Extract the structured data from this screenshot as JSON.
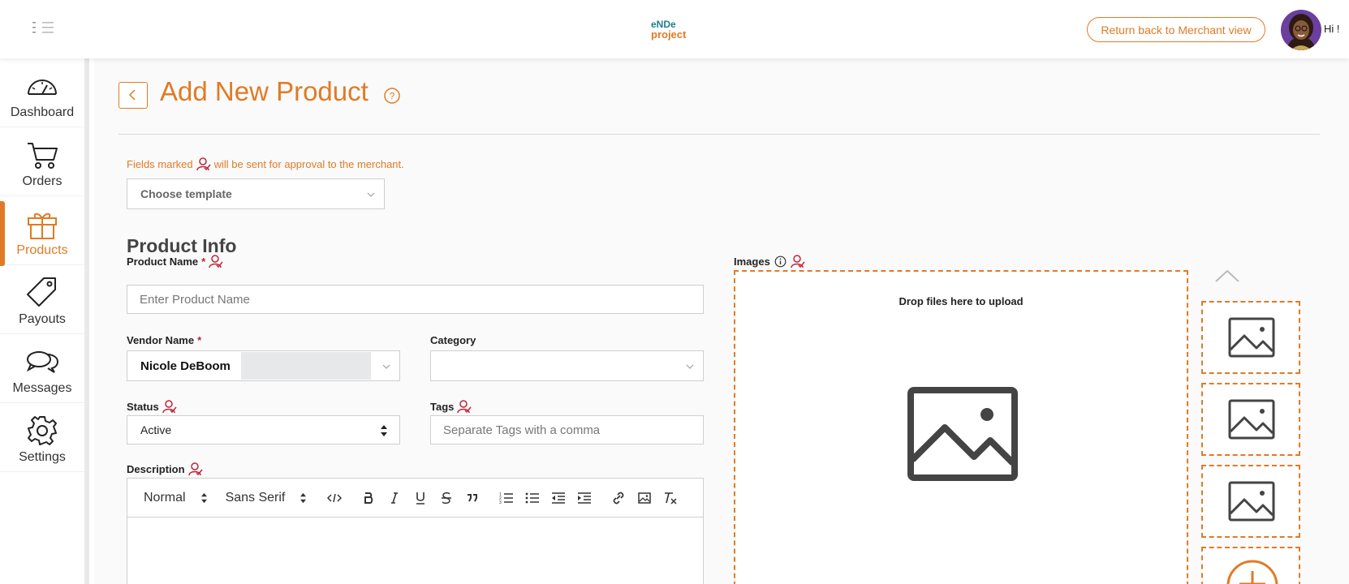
{
  "header": {
    "logo_line1": "eNDe",
    "logo_line2": "project",
    "merchant_button": "Return back to Merchant view",
    "greeting": "Hi !"
  },
  "sidebar": {
    "items": [
      {
        "label": "Dashboard",
        "icon": "gauge-icon"
      },
      {
        "label": "Orders",
        "icon": "cart-icon"
      },
      {
        "label": "Products",
        "icon": "gift-icon",
        "active": true
      },
      {
        "label": "Payouts",
        "icon": "tag-icon"
      },
      {
        "label": "Messages",
        "icon": "chat-bubbles-icon"
      },
      {
        "label": "Settings",
        "icon": "gear-icon"
      }
    ]
  },
  "page": {
    "title": "Add New Product",
    "approval_note_before": "Fields marked",
    "approval_note_after": "will be sent for approval to the merchant.",
    "template_placeholder": "Choose template",
    "section_title": "Product Info"
  },
  "form": {
    "product_name_label": "Product Name",
    "product_name_placeholder": "Enter Product Name",
    "vendor_label": "Vendor Name",
    "vendor_value": "Nicole DeBoom",
    "category_label": "Category",
    "category_value": "",
    "status_label": "Status",
    "status_value": "Active",
    "tags_label": "Tags",
    "tags_placeholder": "Separate Tags with a comma",
    "description_label": "Description",
    "required_mark": "*"
  },
  "editor": {
    "format_value": "Normal",
    "font_value": "Sans Serif"
  },
  "images": {
    "label": "Images",
    "drop_text": "Drop files here to upload"
  },
  "colors": {
    "accent": "#e07b25",
    "approval_icon": "#c0243a"
  }
}
